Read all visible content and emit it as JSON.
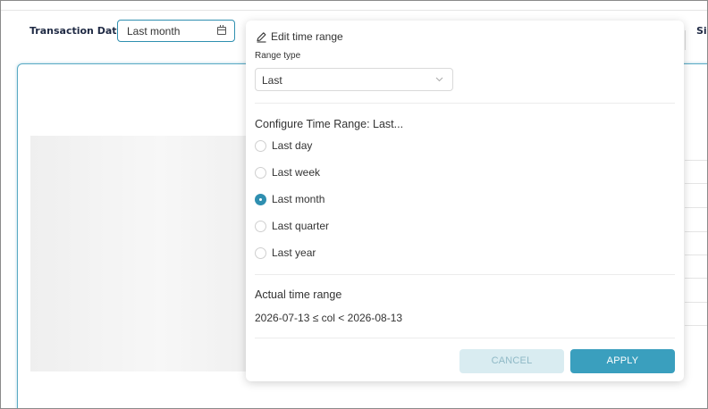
{
  "filter": {
    "label": "Transaction Date",
    "value": "Last month",
    "next_label": "Si"
  },
  "popover": {
    "title": "Edit time range",
    "range_type_label": "Range type",
    "range_type_value": "Last",
    "configure_title": "Configure Time Range: Last...",
    "options": [
      {
        "label": "Last day",
        "checked": false
      },
      {
        "label": "Last week",
        "checked": false
      },
      {
        "label": "Last month",
        "checked": true
      },
      {
        "label": "Last quarter",
        "checked": false
      },
      {
        "label": "Last year",
        "checked": false
      }
    ],
    "actual_title": "Actual time range",
    "actual_range": "2026-07-13 ≤ col < 2026-08-13",
    "cancel_label": "CANCEL",
    "apply_label": "APPLY"
  },
  "colors": {
    "accent": "#3a9fbe",
    "accent_light": "#d9ecf1",
    "label_navy": "#1f2a44"
  }
}
